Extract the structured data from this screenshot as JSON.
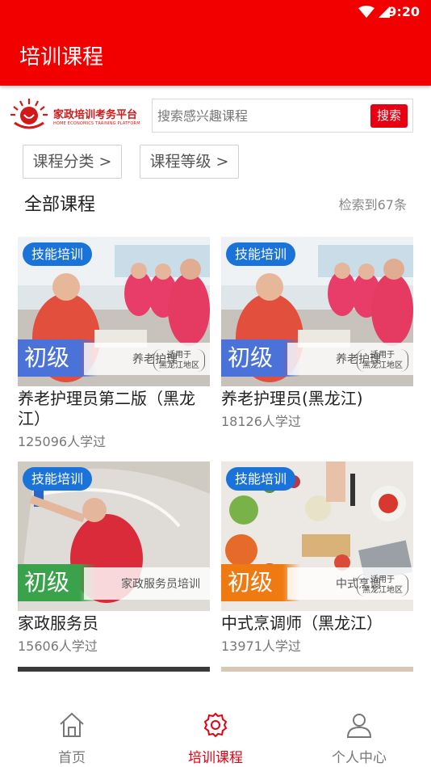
{
  "status_bar": {
    "time": "9:20"
  },
  "app_bar": {
    "title": "培训课程"
  },
  "logo": {
    "name_cn": "家政培训考务平台",
    "name_en": "HOME ECONOMICS TRAINING PLATFORM"
  },
  "search": {
    "placeholder": "搜索感兴趣课程",
    "button_label": "搜索"
  },
  "filters": {
    "category": "课程分类 >",
    "level": "课程等级 >"
  },
  "section": {
    "title": "全部课程",
    "result_count": "检索到67条"
  },
  "courses": [
    {
      "tag": "技能培训",
      "level": "初级",
      "band_text": "养老护理",
      "band_note": "适用于\n黑龙江地区",
      "title": "养老护理员第二版（黑龙江）",
      "learners": "125096人学过",
      "level_color": "#4a72d8",
      "image": "elder-care-training-photo"
    },
    {
      "tag": "技能培训",
      "level": "初级",
      "band_text": "养老护理",
      "band_note": "适用于\n黑龙江地区",
      "title": "养老护理员(黑龙江)",
      "learners": "18126人学过",
      "level_color": "#4a72d8",
      "image": "elder-care-training-photo"
    },
    {
      "tag": "技能培训",
      "level": "初级",
      "band_text": "家政服务员培训",
      "band_note": "",
      "title": "家政服务员",
      "learners": "15606人学过",
      "level_color": "#3aa24a",
      "image": "window-cleaning-photo"
    },
    {
      "tag": "技能培训",
      "level": "初级",
      "band_text": "中式烹调",
      "band_note": "适用于\n黑龙江地区",
      "title": "中式烹调师（黑龙江）",
      "learners": "13971人学过",
      "level_color": "#f07a12",
      "image": "cooking-ingredients-photo"
    }
  ],
  "tab_bar": [
    {
      "label": "首页",
      "icon": "home-icon",
      "active": false
    },
    {
      "label": "培训课程",
      "icon": "gear-icon",
      "active": true
    },
    {
      "label": "个人中心",
      "icon": "person-icon",
      "active": false
    }
  ],
  "colors": {
    "brand_red": "#f20000",
    "search_button": "#e60012",
    "tag_blue": "#1a73d9",
    "active_tab": "#e60012"
  }
}
